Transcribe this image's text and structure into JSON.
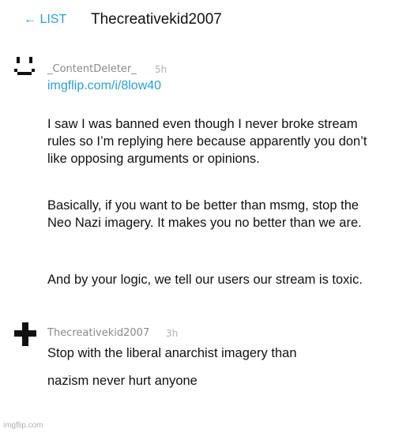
{
  "header": {
    "back_label": "← LIST",
    "title": "Thecreativekid2007"
  },
  "comments": [
    {
      "username": "_ContentDeleter_",
      "time": "5h",
      "link": "imgflip.com/i/8low40",
      "paragraphs": [
        "I saw I was banned even though I never broke stream rules so I’m replying here because apparently you don’t like opposing arguments or opinions.",
        "Basically, if you want to be better than msmg, stop the Neo Nazi imagery. It makes you no better than we are.",
        "And by your logic, we tell our users our stream is toxic."
      ]
    },
    {
      "username": "Thecreativekid2007",
      "time": "3h",
      "paragraphs": [
        "Stop with the liberal anarchist imagery than",
        "nazism never hurt anyone"
      ]
    }
  ],
  "footer": {
    "watermark": "imgflip.com"
  },
  "colors": {
    "accent": "#2a9fd6",
    "muted": "#8a8a8a",
    "text": "#111111"
  }
}
